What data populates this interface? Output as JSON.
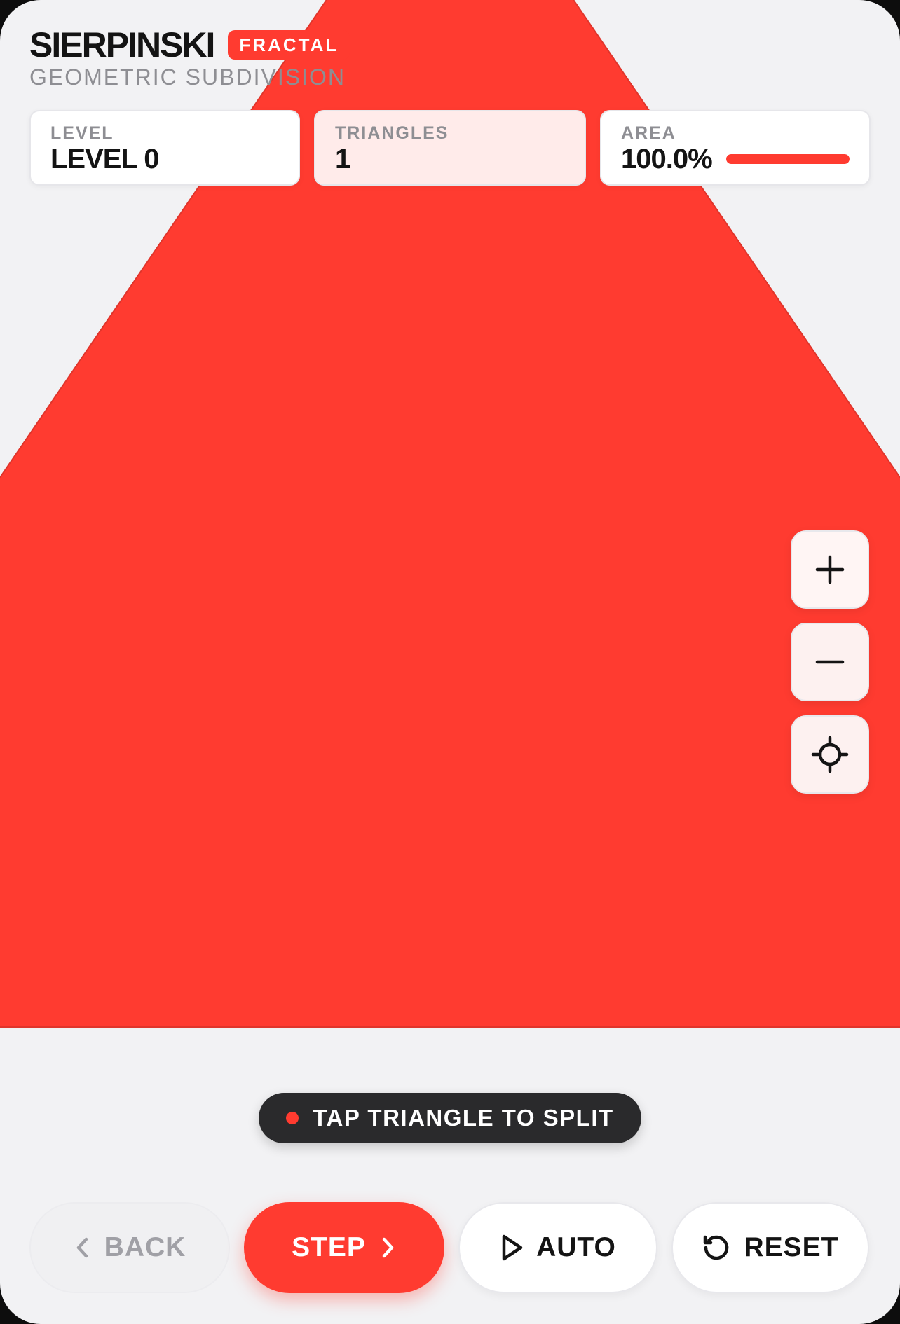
{
  "app": {
    "title": "SIERPINSKI",
    "badge": "FRACTAL",
    "subtitle": "GEOMETRIC SUBDIVISION"
  },
  "stats": {
    "level": {
      "label": "LEVEL",
      "value": "LEVEL 0"
    },
    "triangles": {
      "label": "TRIANGLES",
      "value": "1"
    },
    "area": {
      "label": "AREA",
      "value": "100.0%",
      "fill_fraction": 1.0
    }
  },
  "canvas": {
    "fill_color": "#ff3b30",
    "level": 0,
    "triangle_count": 1
  },
  "zoom_controls": {
    "icons": [
      "plus-icon",
      "minus-icon",
      "crosshair-icon"
    ]
  },
  "hint": {
    "text": "TAP TRIANGLE TO SPLIT"
  },
  "controls": {
    "back_label": "BACK",
    "step_label": "STEP",
    "auto_label": "AUTO",
    "reset_label": "RESET",
    "back_enabled": false
  },
  "colors": {
    "accent": "#ff3b30",
    "dark": "#141414",
    "muted": "#8e8e93",
    "background": "#f2f2f4"
  }
}
